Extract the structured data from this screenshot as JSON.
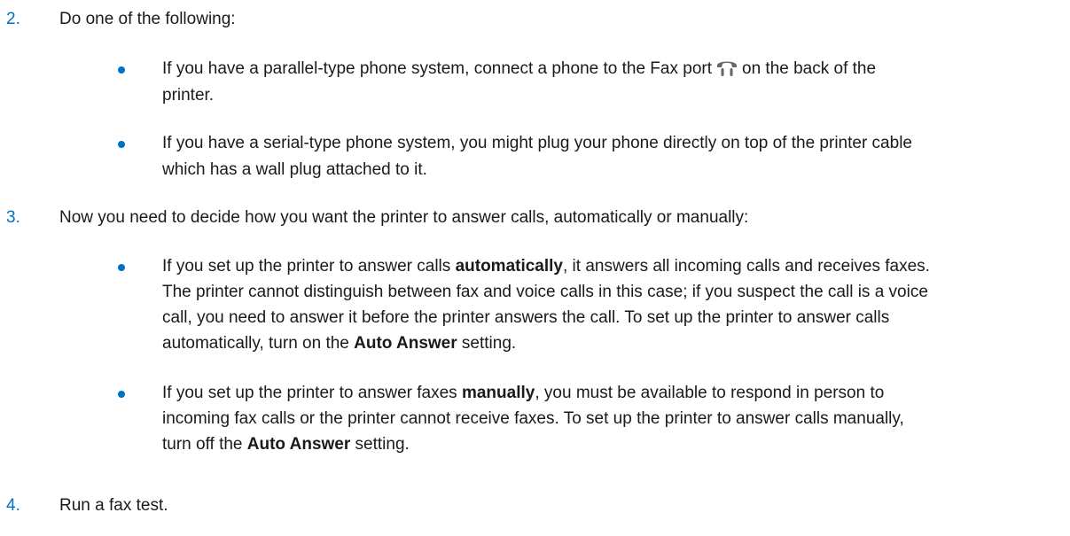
{
  "steps": [
    {
      "number": "2.",
      "text": "Do one of the following:"
    },
    {
      "number": "3.",
      "text": "Now you need to decide how you want the printer to answer calls, automatically or manually:"
    },
    {
      "number": "4.",
      "text": "Run a fax test."
    }
  ],
  "step2_bullets": {
    "parallel": {
      "line1_before_icon": "If you have a parallel-type phone system, connect a phone to the Fax port",
      "icon": "phone-handset-icon",
      "line1_after_icon": "on the back of the",
      "line2": "printer."
    },
    "serial": {
      "line1": "If you have a serial-type phone system, you might plug your phone directly on top of the printer cable",
      "line2": "which has a wall plug attached to it."
    }
  },
  "step3_bullets": {
    "auto": {
      "line1_pre": "If you set up the printer to answer calls ",
      "line1_bold": "automatically",
      "line1_post": ", it answers all incoming calls and receives faxes.",
      "line2": "The printer cannot distinguish between fax and voice calls in this case; if you suspect the call is a voice",
      "line3": "call, you need to answer it before the printer answers the call. To set up the printer to answer calls",
      "line4_pre": "automatically, turn on the ",
      "line4_bold": "Auto Answer",
      "line4_post": " setting."
    },
    "manual": {
      "line1_pre": "If you set up the printer to answer faxes ",
      "line1_bold": "manually",
      "line1_post": ", you must be available to respond in person to",
      "line2": "incoming fax calls or the printer cannot receive faxes. To set up the printer to answer calls manually,",
      "line3_pre": "turn off the ",
      "line3_bold": "Auto Answer",
      "line3_post": " setting."
    }
  },
  "colors": {
    "accent": "#0071c5",
    "text": "#1a1a1a"
  }
}
